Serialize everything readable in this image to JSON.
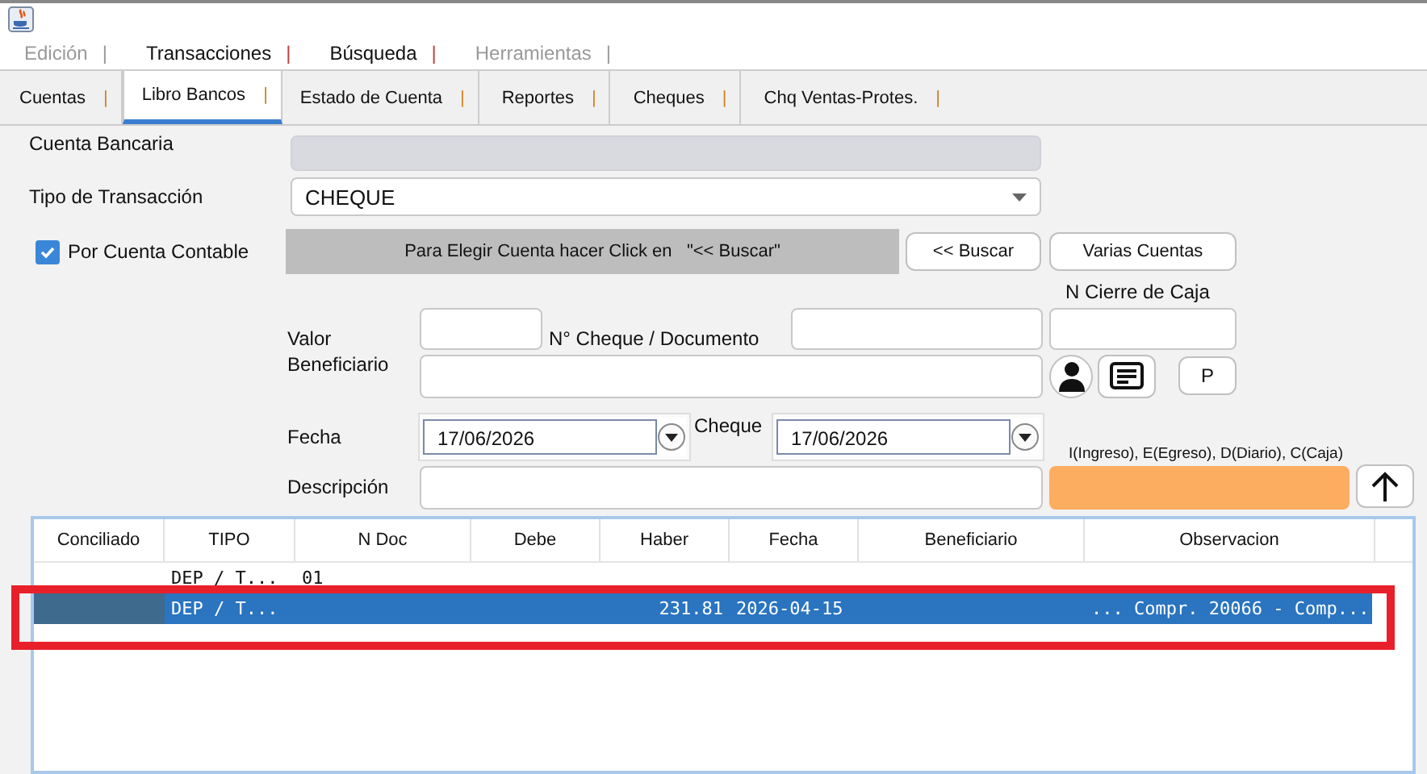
{
  "menu": [
    {
      "label": "Edición",
      "separator": "|",
      "disabled": true
    },
    {
      "label": "Transacciones",
      "separator": "|",
      "disabled": false
    },
    {
      "label": "Búsqueda",
      "separator": "|",
      "disabled": false
    },
    {
      "label": "Herramientas",
      "separator": "|",
      "disabled": true
    }
  ],
  "tabs": [
    {
      "label": "Cuentas",
      "separator": "|",
      "selected": false
    },
    {
      "label": "Libro Bancos",
      "separator": "|",
      "selected": true
    },
    {
      "label": "Estado de Cuenta",
      "separator": "|",
      "selected": false
    },
    {
      "label": "Reportes",
      "separator": "|",
      "selected": false
    },
    {
      "label": "Cheques",
      "separator": "|",
      "selected": false
    },
    {
      "label": "Chq Ventas-Protes.",
      "separator": "|",
      "selected": false
    }
  ],
  "form": {
    "cuenta_bancaria_label": "Cuenta Bancaria",
    "tipo_label": "Tipo de Transacción",
    "tipo_value": "CHEQUE",
    "por_cuenta": {
      "label": "Por Cuenta Contable",
      "checked": true
    },
    "hint": "Para Elegir Cuenta hacer Click en   \"<< Buscar\"",
    "buscar_button": "<< Buscar",
    "varias_button": "Varias Cuentas",
    "cierre_label": "N Cierre de Caja",
    "valor_label": "Valor",
    "cheque_doc_label": "N° Cheque / Documento",
    "beneficiario_label": "Beneficiario",
    "p_button": "P",
    "fecha_label": "Fecha",
    "fecha_value": "17/06/2026",
    "cheque_label": "Cheque",
    "cheque_value": "17/06/2026",
    "tipo_hint": "I(Ingreso), E(Egreso), D(Diario), C(Caja)",
    "descripcion_label": "Descripción"
  },
  "table": {
    "columns": [
      "Conciliado",
      "TIPO",
      "N Doc",
      "Debe",
      "Haber",
      "Fecha",
      "Beneficiario",
      "Observacion"
    ],
    "rows": [
      {
        "selected": false,
        "cells": [
          null,
          "DEP / T...",
          "01",
          null,
          null,
          null,
          null,
          null
        ]
      },
      {
        "selected": true,
        "cells": [
          null,
          "DEP / T...",
          null,
          null,
          "231.81",
          "2026-04-15",
          null,
          "... Compr. 20066 - Comp..."
        ]
      }
    ]
  }
}
